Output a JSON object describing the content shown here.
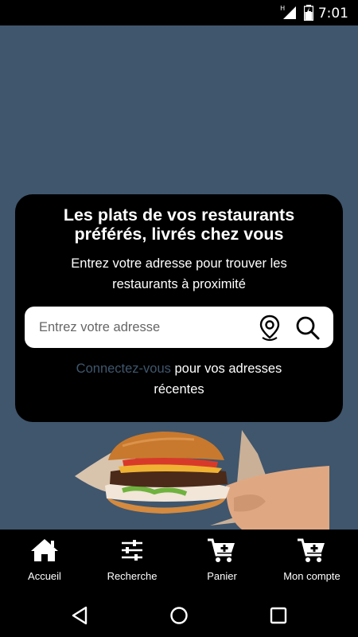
{
  "status_bar": {
    "time": "7:01",
    "network_label": "H"
  },
  "hero": {
    "title_line1": "Les plats de vos restaurants",
    "title_line2": "préférés, livrés chez vous",
    "subtitle_line1": "Entrez votre adresse pour trouver les",
    "subtitle_line2": "restaurants à proximité",
    "search_placeholder": "Entrez votre adresse",
    "link_text": "Connectez-vous",
    "footer_after_link": " pour vos adresses",
    "footer_line2": "récentes"
  },
  "bottom_nav": {
    "items": [
      {
        "label": "Accueil",
        "icon": "home-icon"
      },
      {
        "label": "Recherche",
        "icon": "sliders-icon"
      },
      {
        "label": "Panier",
        "icon": "cart-add-icon"
      },
      {
        "label": "Mon compte",
        "icon": "cart-add-icon"
      }
    ]
  },
  "colors": {
    "accent": "#3f566d",
    "card": "#000000",
    "bar": "#000000"
  }
}
